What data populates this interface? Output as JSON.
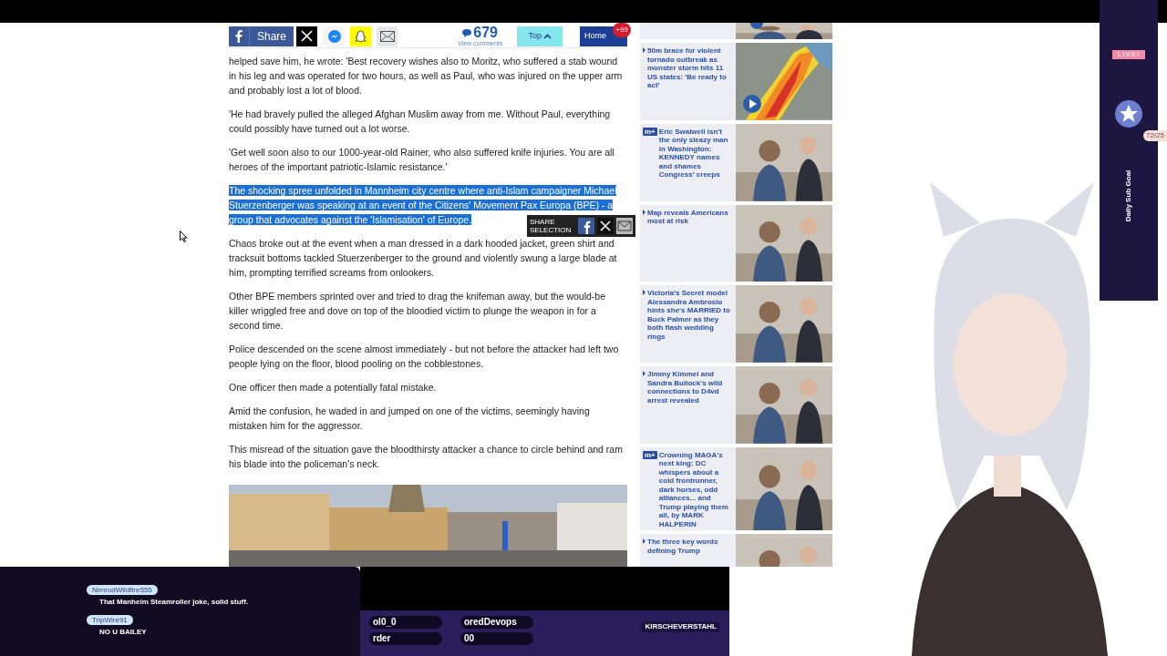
{
  "toolbar": {
    "share_label": "Share",
    "comment_count": "679",
    "comment_caption": "View comments",
    "top_label": "Top",
    "home_label": "Home",
    "notification_badge": "+99"
  },
  "article": {
    "paragraphs": [
      {
        "text": "helped save him, he wrote: 'Best recovery wishes also to Moritz, who suffered a stab wound in his leg and was operated for two hours, as well as Paul, who was injured on the upper arm and probably lost a lot of blood.",
        "selected": false
      },
      {
        "text": "'He had bravely pulled the alleged Afghan Muslim away from me. Without Paul, everything could possibly have turned out a lot worse.",
        "selected": false
      },
      {
        "text": "'Get well soon also to our 1000-year-old Rainer, who also suffered knife injuries. You are all heroes of the important patriotic-Islamic resistance.'",
        "selected": false
      },
      {
        "text": "The shocking spree unfolded in Mannheim city centre where anti-Islam campaigner Michael Stuerzenberger was speaking at an event of the Citizens' Movement Pax Europa (BPE) - a group that advocates against the 'Islamisation' of Europe.",
        "selected": true
      },
      {
        "text": "Chaos broke out at the event when a man dressed in a dark hooded jacket, green shirt and tracksuit bottoms tackled Stuerzenberger to the ground and violently swung a large blade at him, prompting terrified screams from onlookers.",
        "selected": false
      },
      {
        "text": "Other BPE members sprinted over and tried to drag the knifeman away, but the would-be killer wriggled free and dove on top of the bloodied victim to plunge the weapon in for a second time.",
        "selected": false
      },
      {
        "text": "Police descended on the scene almost immediately - but not before the attacker had left two people lying on the floor, blood pooling on the cobblestones.",
        "selected": false
      },
      {
        "text": "One officer then made a potentially fatal mistake.",
        "selected": false
      },
      {
        "text": "Amid the confusion, he waded in and jumped on one of the victims, seemingly having mistaken him for the aggressor.",
        "selected": false
      },
      {
        "text": "This misread of the situation gave the bloodthirsty attacker a chance to circle behind and ram his blade into the policeman's neck.",
        "selected": false
      }
    ]
  },
  "share_popup": {
    "label": "SHARE SELECTION"
  },
  "sidebar": [
    {
      "kind": "cut",
      "video": true
    },
    {
      "kind": "story",
      "headline": "50m brace for violent tornado outbreak as monster storm hits 11 US states: 'Be ready to act'",
      "video": true
    },
    {
      "kind": "story",
      "badge": "m+",
      "headline": "Eric Swalwell isn't the only sleazy man in Washington: KENNEDY names and shames Congress' creeps",
      "video": false
    },
    {
      "kind": "story",
      "headline": "Map reveals Americans most at risk",
      "video": false
    },
    {
      "kind": "story",
      "headline": "Victoria's Secret model Alessandra Ambrosio hints she's MARRIED to Buck Palmer as they both flash wedding rings",
      "video": false
    },
    {
      "kind": "story",
      "headline": "Jimmy Kimmel and Sandra Bullock's wild connections to D4vd arrest revealed",
      "video": false
    },
    {
      "kind": "story",
      "badge": "m+",
      "headline": "Crowning MAGA's next king: DC whispers about a cold frontrunner, dark horses, odd alliances... and Trump playing them all, by MARK HALPERIN",
      "video": false
    },
    {
      "kind": "story",
      "headline": "The three key words defining Trump",
      "video": false
    }
  ],
  "chat": [
    {
      "user": "NimrodWildfire555",
      "message": "That Manheim Steamroller joke, solid stuff."
    },
    {
      "user": "TripWire91",
      "message": "NO U BAILEY"
    }
  ],
  "stream_bar": {
    "labels": [
      "ol0_0",
      "oredDevops",
      "rder",
      "00"
    ],
    "social_handle": "KIRSCHEVERSTAHL"
  },
  "sub_goal": {
    "live_tag": "LIVE!",
    "title": "Daily Sub Goal",
    "count": "72/25"
  }
}
